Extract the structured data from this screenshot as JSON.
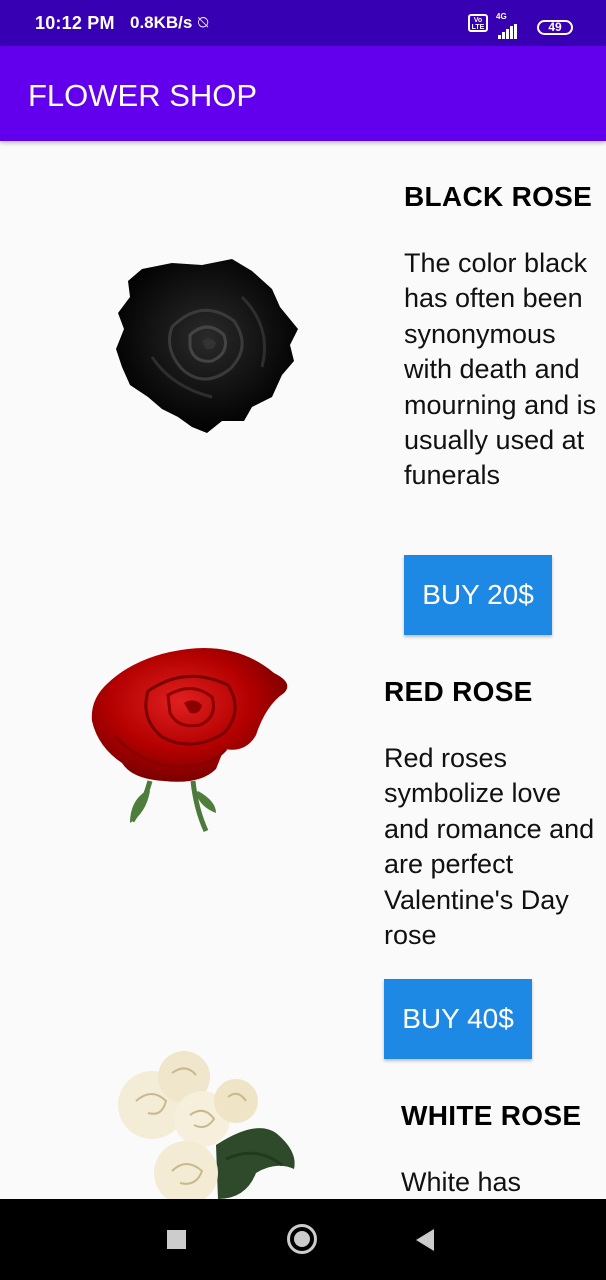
{
  "status_bar": {
    "time": "10:12 PM",
    "net_speed": "0.8KB/s",
    "mute_icon": "⍉",
    "volte": "Vo\nLTE",
    "network_label": "4G",
    "battery": "49"
  },
  "app_bar": {
    "title": "FLOWER SHOP",
    "color": "#6200EE",
    "status_color": "#3700B3"
  },
  "products": [
    {
      "name": "BLACK ROSE",
      "description": "The color black has often been synonymous with death and mourning and is usually used at funerals",
      "button_label": "BUY 20$",
      "image": "black-rose-image"
    },
    {
      "name": "RED ROSE",
      "description": "Red roses symbolize love and romance and are perfect Valentine's Day rose",
      "button_label": "BUY 40$",
      "image": "red-rose-image"
    },
    {
      "name": "WHITE ROSE",
      "description": "White has",
      "image": "white-roses-image"
    }
  ],
  "button_color": "#1E88E5",
  "nav_bar": {
    "recents": "square-icon",
    "home": "circle-icon",
    "back": "triangle-back-icon"
  }
}
